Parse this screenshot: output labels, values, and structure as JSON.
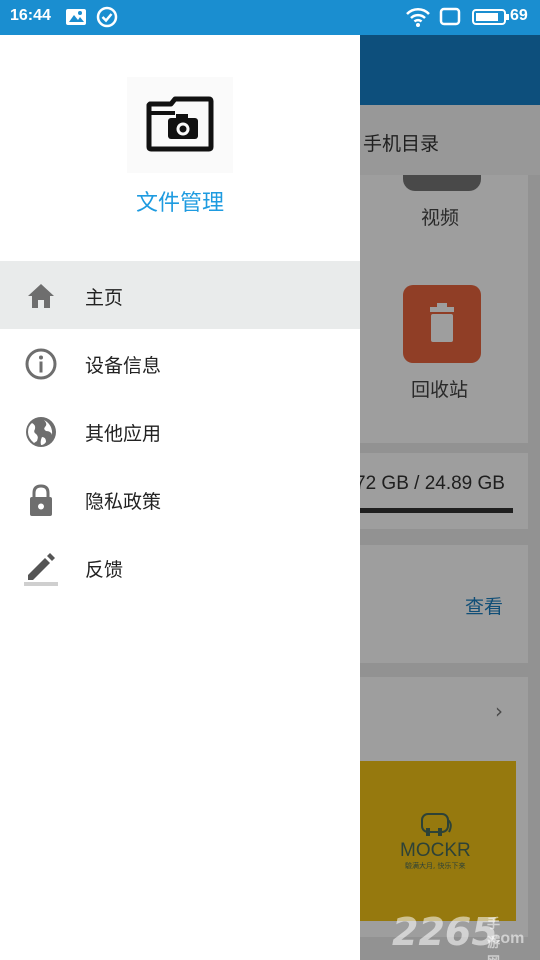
{
  "status_bar": {
    "time": "16:44",
    "battery_level": "69",
    "icons": [
      "image-notification-icon",
      "check-circle-icon",
      "wifi-icon",
      "screen-cast-icon",
      "battery-icon"
    ]
  },
  "background_app": {
    "tab_label": "手机目录",
    "video_label": "视频",
    "recycle_label": "回收站",
    "storage_text": "72 GB / 24.89 GB",
    "view_label": "查看",
    "ad": {
      "brand": "MOCKR",
      "slogan": "驗满大月, 快乐下来"
    }
  },
  "watermark": {
    "number": "2265",
    "site": "手游网",
    "domain": ".com"
  },
  "drawer": {
    "app_name": "文件管理",
    "menu": [
      {
        "label": "主页",
        "icon": "home-icon",
        "active": true
      },
      {
        "label": "设备信息",
        "icon": "info-icon",
        "active": false
      },
      {
        "label": "其他应用",
        "icon": "globe-icon",
        "active": false
      },
      {
        "label": "隐私政策",
        "icon": "lock-icon",
        "active": false
      },
      {
        "label": "反馈",
        "icon": "pencil-icon",
        "active": false
      }
    ]
  },
  "colors": {
    "status_bar": "#1a8ed0",
    "accent": "#1e9be0",
    "active_item_bg": "#e9ebeb",
    "icon_gray": "#6e6e6e"
  }
}
